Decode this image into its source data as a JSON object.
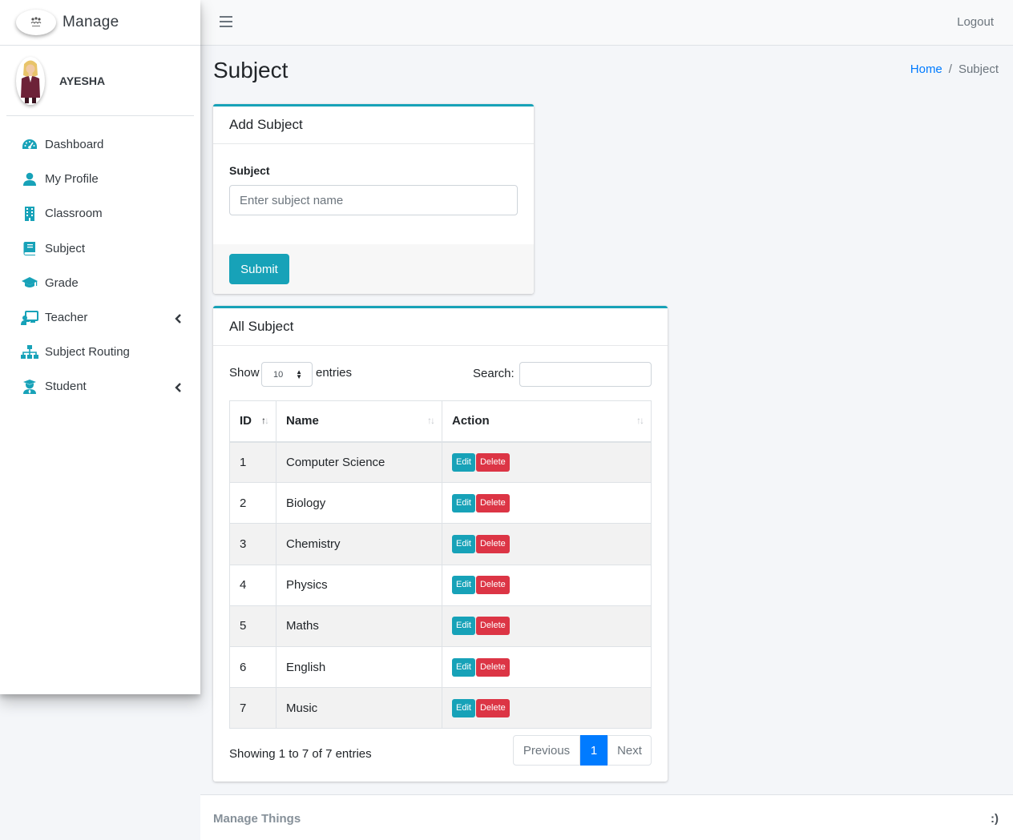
{
  "brand": {
    "name": "Manage"
  },
  "user": {
    "name": "AYESHA"
  },
  "sidebar": {
    "items": [
      {
        "label": "Dashboard",
        "icon": "dashboard-icon"
      },
      {
        "label": "My Profile",
        "icon": "user-icon"
      },
      {
        "label": "Classroom",
        "icon": "building-icon"
      },
      {
        "label": "Subject",
        "icon": "book-icon"
      },
      {
        "label": "Grade",
        "icon": "graduation-cap-icon"
      },
      {
        "label": "Teacher",
        "icon": "chalkboard-teacher-icon",
        "has_caret": true
      },
      {
        "label": "Subject Routing",
        "icon": "sitemap-icon"
      },
      {
        "label": "Student",
        "icon": "user-graduate-icon",
        "has_caret": true
      }
    ]
  },
  "topbar": {
    "logout_label": "Logout"
  },
  "page": {
    "title": "Subject",
    "breadcrumb": {
      "home": "Home",
      "separator": "/",
      "current": "Subject"
    }
  },
  "add_card": {
    "title": "Add Subject",
    "field_label": "Subject",
    "placeholder": "Enter subject name",
    "submit_label": "Submit"
  },
  "list_card": {
    "title": "All Subject",
    "show_label": "Show",
    "page_length": "10",
    "entries_label": "entries",
    "search_label": "Search:",
    "columns": [
      "ID",
      "Name",
      "Action"
    ],
    "rows": [
      {
        "id": "1",
        "name": "Computer Science"
      },
      {
        "id": "2",
        "name": "Biology"
      },
      {
        "id": "3",
        "name": "Chemistry"
      },
      {
        "id": "4",
        "name": "Physics"
      },
      {
        "id": "5",
        "name": "Maths"
      },
      {
        "id": "6",
        "name": "English"
      },
      {
        "id": "7",
        "name": "Music"
      }
    ],
    "edit_label": "Edit",
    "delete_label": "Delete",
    "info": "Showing 1 to 7 of 7 entries",
    "pagination": {
      "previous": "Previous",
      "current": "1",
      "next": "Next"
    }
  },
  "footer": {
    "left": "Manage Things",
    "right": ":)"
  },
  "colors": {
    "accent": "#17a2b8",
    "danger": "#dc3545",
    "link": "#007bff"
  }
}
